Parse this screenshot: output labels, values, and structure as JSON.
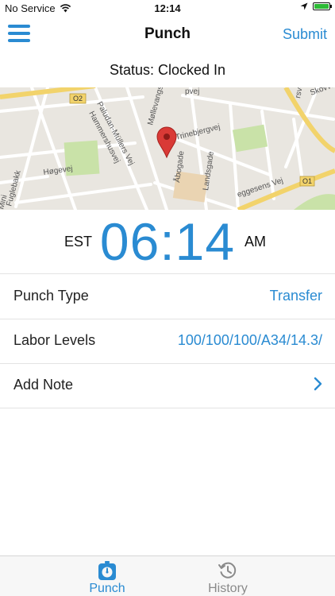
{
  "status_bar": {
    "carrier": "No Service",
    "time": "12:14"
  },
  "nav": {
    "title": "Punch",
    "submit_label": "Submit"
  },
  "status": {
    "text": "Status: Clocked In"
  },
  "map": {
    "labels": {
      "road_o2": "O2",
      "road_o1": "O1",
      "paludan": "Paludan-Müllers Vej",
      "hammershus": "Hammershusvej",
      "hojevej": "Høgevej",
      "molle": "Møllevangs Allé",
      "trinebjerg": "Trinebjergvej",
      "abogade": "Åbogade",
      "landsgade": "Landsgade",
      "skovva": "Skovva",
      "rsvej": "rsvej",
      "geggesens": "eggesens Vej",
      "fuglebakk": "Fuglebakk",
      "mini": "Mini",
      "nopvej": "pvej"
    }
  },
  "clock": {
    "timezone": "EST",
    "time": "06:14",
    "ampm": "AM"
  },
  "rows": [
    {
      "label": "Punch Type",
      "value": "Transfer"
    },
    {
      "label": "Labor Levels",
      "value": "100/100/100/A34/14.3/"
    },
    {
      "label": "Add Note",
      "value": ""
    }
  ],
  "tabs": {
    "punch": "Punch",
    "history": "History"
  },
  "colors": {
    "accent": "#2a8bd2",
    "battery": "#2dbb36",
    "map_pin": "#d93a36"
  }
}
